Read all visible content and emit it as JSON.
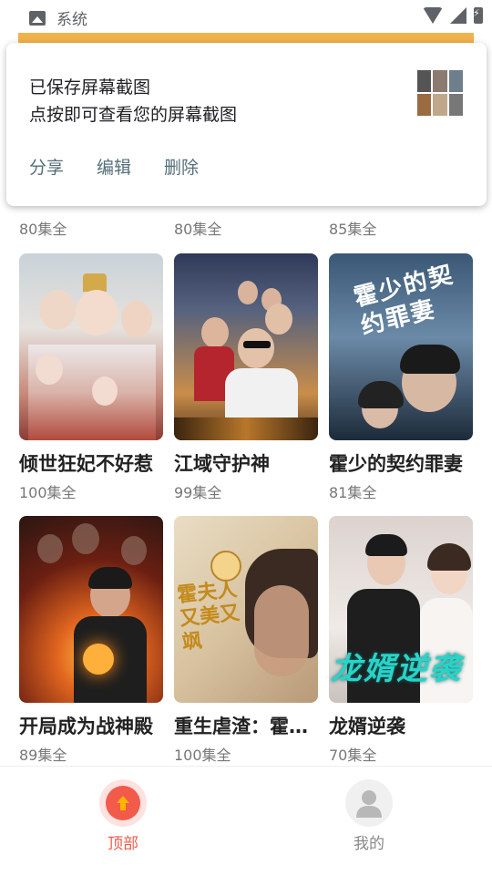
{
  "status_bar": {
    "app_label": "系统"
  },
  "notification": {
    "line1": "已保存屏幕截图",
    "line2": "点按即可查看您的屏幕截图",
    "actions": [
      "分享",
      "编辑",
      "删除"
    ]
  },
  "top_row_episodes": [
    "80集全",
    "80集全",
    "85集全"
  ],
  "dramas": [
    {
      "title": "倾世狂妃不好惹",
      "episodes": "100集全"
    },
    {
      "title": "江域守护神",
      "episodes": "99集全"
    },
    {
      "title": "霍少的契约罪妻",
      "episodes": "81集全"
    },
    {
      "title": "开局成为战神殿",
      "episodes": "89集全"
    },
    {
      "title": "重生虐渣：霍夫人",
      "episodes": "100集全"
    },
    {
      "title": "龙婿逆袭",
      "episodes": "70集全"
    }
  ],
  "poster_text": {
    "huo_shao": "霍少的契约罪妻",
    "chong_sheng": "霍夫人又美又飒",
    "long_xu": "龙婿逆袭"
  },
  "bottom_nav": [
    {
      "label": "顶部",
      "active": true,
      "color": "#f25a4a"
    },
    {
      "label": "我的",
      "active": false,
      "color": "#888888"
    }
  ]
}
